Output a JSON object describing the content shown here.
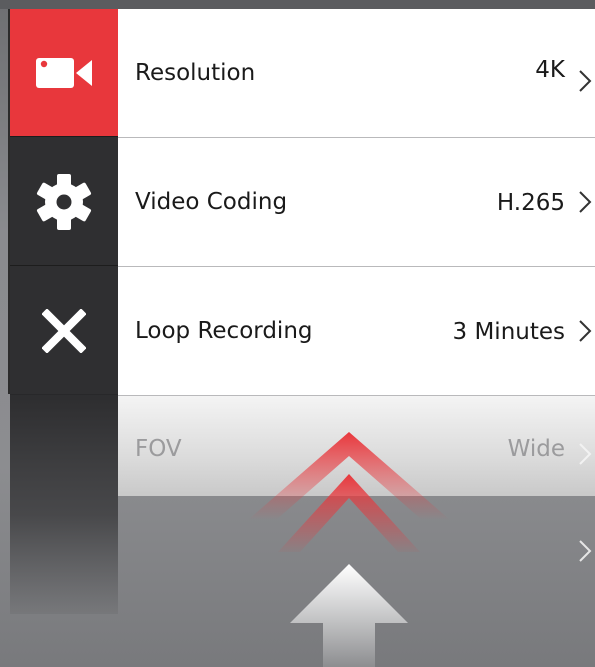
{
  "sidebar": {
    "items": [
      {
        "name": "camera-icon",
        "active": true
      },
      {
        "name": "gear-icon",
        "active": false
      },
      {
        "name": "close-icon",
        "active": false
      }
    ]
  },
  "menu": {
    "rows": [
      {
        "label": "Resolution",
        "value": "4K"
      },
      {
        "label": "Video Coding",
        "value": "H.265"
      },
      {
        "label": "Loop Recording",
        "value": "3 Minutes"
      },
      {
        "label": "FOV",
        "value": "Wide"
      },
      {
        "label": "",
        "value": ""
      }
    ]
  },
  "colors": {
    "accent": "#e8373c",
    "sidebar_dark": "#2f2f31",
    "row_bg": "#ffffff",
    "text": "#1a1a1a"
  },
  "gesture": {
    "icon": "swipe-up-arrows-icon"
  }
}
